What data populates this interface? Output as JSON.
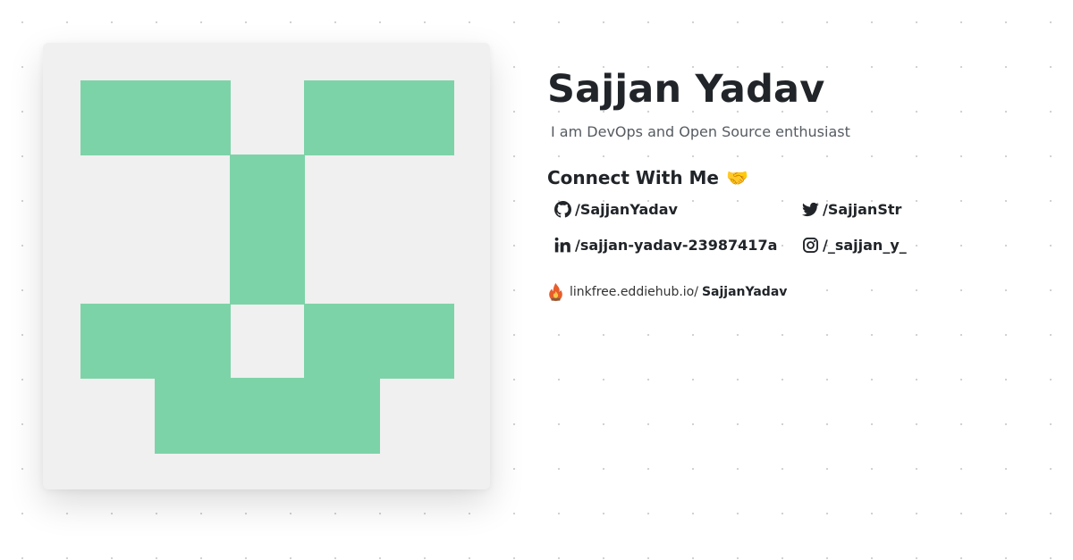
{
  "profile": {
    "name": "Sajjan Yadav",
    "bio": "I am DevOps and Open Source enthusiast",
    "avatar_color": "#7dd3a8",
    "avatar_background": "#f0f0f0"
  },
  "connect": {
    "heading": "Connect With Me",
    "emoji": "🤝",
    "links": [
      {
        "icon": "github-icon",
        "label": "/SajjanYadav"
      },
      {
        "icon": "twitter-icon",
        "label": "/SajjanStr"
      },
      {
        "icon": "linkedin-icon",
        "label": "/sajjan-yadav-23987417a"
      },
      {
        "icon": "instagram-icon",
        "label": "/_sajjan_y_"
      }
    ]
  },
  "linkfree": {
    "icon": "linkfree-flame-icon",
    "prefix": "linkfree.eddiehub.io/",
    "username": "SajjanYadav"
  }
}
